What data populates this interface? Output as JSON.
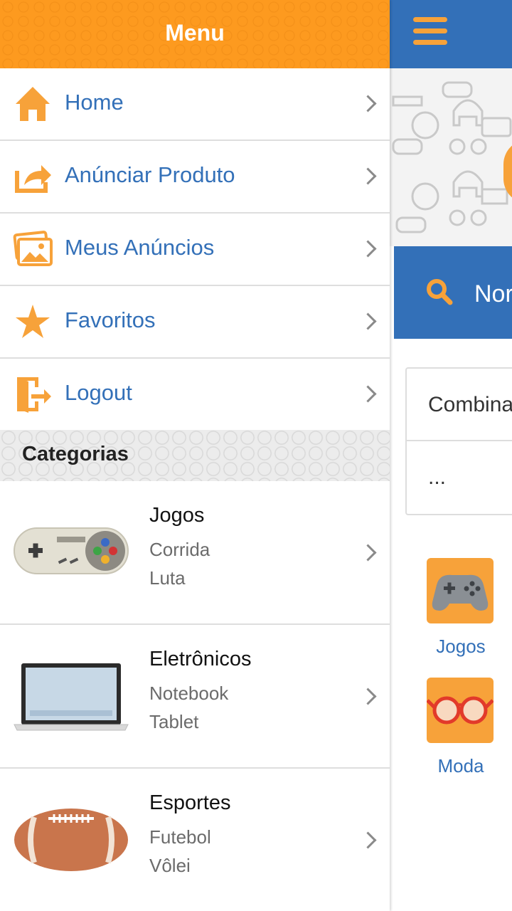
{
  "drawer": {
    "title": "Menu",
    "items": [
      {
        "label": "Home",
        "icon": "home-icon"
      },
      {
        "label": "Anúnciar Produto",
        "icon": "share-icon"
      },
      {
        "label": "Meus Anúncios",
        "icon": "images-icon"
      },
      {
        "label": "Favoritos",
        "icon": "star-icon"
      },
      {
        "label": "Logout",
        "icon": "logout-icon"
      }
    ],
    "categories_header": "Categorias",
    "categories": [
      {
        "title": "Jogos",
        "subs": [
          "Corrida",
          "Luta"
        ],
        "icon": "gamepad-icon"
      },
      {
        "title": "Eletrônicos",
        "subs": [
          "Notebook",
          "Tablet"
        ],
        "icon": "laptop-icon"
      },
      {
        "title": "Esportes",
        "subs": [
          "Futebol",
          "Vôlei"
        ],
        "icon": "football-icon"
      }
    ]
  },
  "app": {
    "search_text": "Nor",
    "combo": [
      "Combina",
      "..."
    ],
    "tiles": [
      {
        "label": "Jogos",
        "icon": "controller-icon"
      },
      {
        "label": "Moda",
        "icon": "glasses-icon"
      }
    ]
  },
  "colors": {
    "orange": "#fd9a1f",
    "blue": "#3370b8",
    "icon_orange": "#f7a23a"
  }
}
